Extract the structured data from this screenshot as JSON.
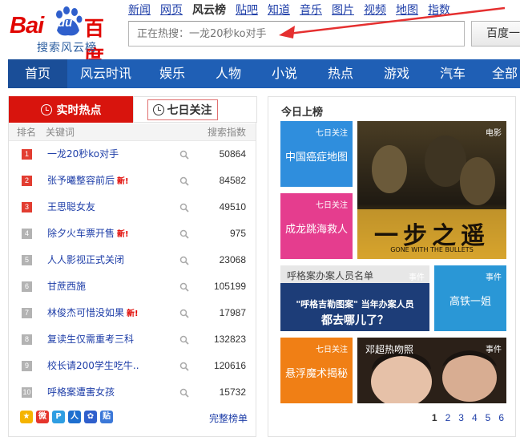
{
  "logo": {
    "bai": "Bai",
    "du": "du",
    "baidu": "百度",
    "sub": "搜索风云榜"
  },
  "topnav": [
    "新闻",
    "网页",
    "风云榜",
    "贴吧",
    "知道",
    "音乐",
    "图片",
    "视频",
    "地图",
    "指数"
  ],
  "topnav_active": "风云榜",
  "search": {
    "placeholder": "正在热搜：一龙20秒ko对手",
    "button": "百度一"
  },
  "bluenav": [
    "首页",
    "风云时讯",
    "娱乐",
    "人物",
    "小说",
    "热点",
    "游戏",
    "汽车",
    "全部"
  ],
  "bluenav_active": "首页",
  "tabs": {
    "hot": "实时热点",
    "week": "七日关注"
  },
  "table_head": {
    "rank": "排名",
    "keyword": "关键词",
    "index": "搜索指数"
  },
  "rows": [
    {
      "rank": "1",
      "keyword": "一龙20秒ko对手",
      "new": "",
      "value": "50864"
    },
    {
      "rank": "2",
      "keyword": "张予曦整容前后",
      "new": "新!",
      "value": "84582"
    },
    {
      "rank": "3",
      "keyword": "王思聪女友",
      "new": "",
      "value": "49510"
    },
    {
      "rank": "4",
      "keyword": "除夕火车票开售",
      "new": "新!",
      "value": "975"
    },
    {
      "rank": "5",
      "keyword": "人人影视正式关闭",
      "new": "",
      "value": "23068"
    },
    {
      "rank": "6",
      "keyword": "甘蔗西施",
      "new": "",
      "value": "105199"
    },
    {
      "rank": "7",
      "keyword": "林俊杰可惜没如果",
      "new": "新!",
      "value": "17987"
    },
    {
      "rank": "8",
      "keyword": "复读生仅需重考三科",
      "new": "",
      "value": "132823"
    },
    {
      "rank": "9",
      "keyword": "校长请200学生吃牛..",
      "new": "",
      "value": "120616"
    },
    {
      "rank": "10",
      "keyword": "呼格案遭害女孩",
      "new": "",
      "value": "15732"
    }
  ],
  "full_list": "完整榜单",
  "right": {
    "title": "今日上榜",
    "tiles": [
      {
        "tag": "七日关注",
        "caption": "中国癌症地图"
      },
      {
        "tag": "七日关注",
        "caption": "成龙跳海救人"
      },
      {
        "tag": "电影",
        "caption": "一步之遥"
      },
      {
        "tag": "事件",
        "caption": "呼格案办案人员名单"
      },
      {
        "tag": "事件",
        "caption": "高铁一姐"
      },
      {
        "tag": "七日关注",
        "caption": "悬浮魔术揭秘"
      },
      {
        "tag": "事件",
        "caption": "邓超热吻照"
      }
    ],
    "poster_title": "一步之遥",
    "poster_sub": "GONE WITH THE BULLETS",
    "hc_line1": "\"呼格吉勒图案\" 当年办案人员",
    "hc_line2": "都去哪儿了？",
    "pages": [
      "1",
      "2",
      "3",
      "4",
      "5",
      "6"
    ],
    "current_page": "1"
  },
  "colors": {
    "brand_red": "#e10601",
    "nav_blue": "#1f5fb5",
    "link_blue": "#1e3ea8"
  }
}
